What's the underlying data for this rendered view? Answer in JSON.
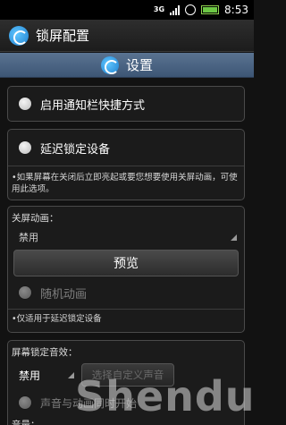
{
  "status_bar": {
    "network": "3G",
    "time": "8:53",
    "icons": [
      "signal-icon",
      "alarm-icon",
      "battery-icon"
    ]
  },
  "app": {
    "title": "锁屏配置",
    "icon": "app-logo-icon"
  },
  "section": {
    "title": "设置"
  },
  "settings": {
    "notification_shortcut": {
      "label": "启用通知栏快捷方式"
    },
    "delay_lock": {
      "label": "延迟锁定设备",
      "note": "•如果屏幕在关闭后立即亮起或要您想要使用关屏动画，可使用此选项。"
    },
    "close_animation": {
      "header": "关屏动画：",
      "selected": "禁用",
      "preview_button": "预览",
      "random_label": "随机动画",
      "note": "•仅适用于延迟锁定设备"
    },
    "lock_sound": {
      "header": "屏幕锁定音效：",
      "selected": "禁用",
      "choose_button": "选择自定义声音",
      "sync_label": "声音与动画同时开始",
      "volume_label": "音量："
    }
  },
  "watermark": "Shendu",
  "colors": {
    "section_header": "#4a6383",
    "card_border": "#4a4a4a",
    "background": "#121212"
  }
}
